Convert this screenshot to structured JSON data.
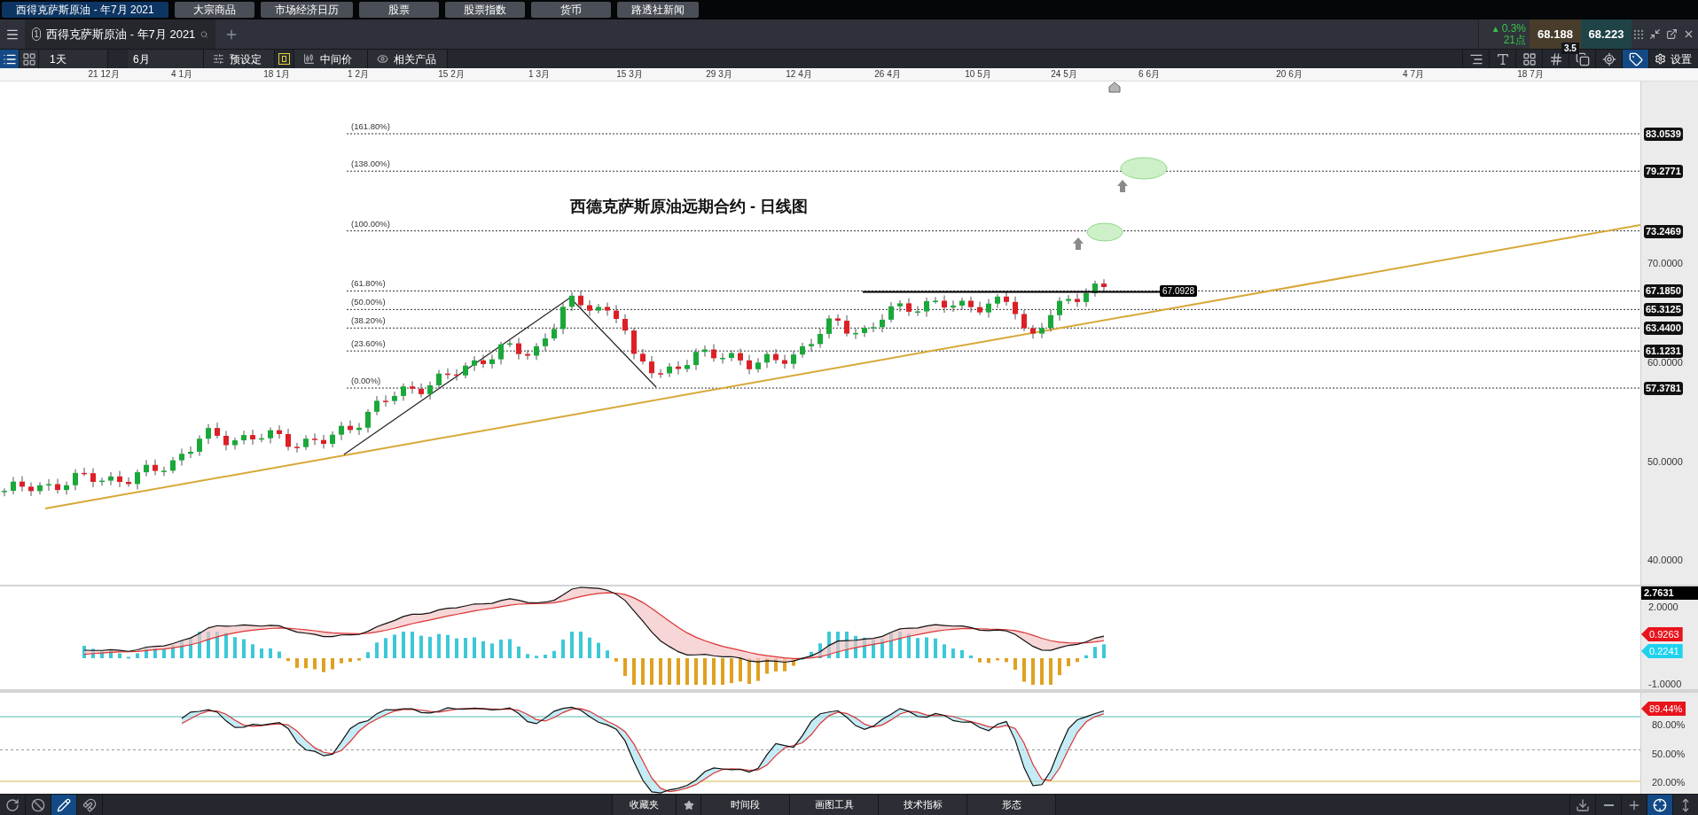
{
  "top_tabs": [
    {
      "label": "西得克萨斯原油 - 年7月 2021",
      "selected": true
    },
    {
      "label": "大宗商品",
      "selected": false
    },
    {
      "label": "市场经济日历",
      "selected": false
    },
    {
      "label": "股票",
      "selected": false
    },
    {
      "label": "股票指数",
      "selected": false
    },
    {
      "label": "货币",
      "selected": false
    },
    {
      "label": "路透社新闻",
      "selected": false
    }
  ],
  "instrument": {
    "index": "1",
    "title": "西得克萨斯原油 - 年7月 2021"
  },
  "quote": {
    "arrow": "▲",
    "change": "0.3%",
    "points": "21点",
    "sell": "68.188",
    "buy": "68.223",
    "spread": "3.5"
  },
  "view_modes": [
    {
      "kind": "list",
      "selected": true
    },
    {
      "kind": "grid",
      "selected": false
    }
  ],
  "toolbar": {
    "interval": "1天",
    "range": "6月",
    "preset": "预设定",
    "price_type": "中间价",
    "related": "相关产品",
    "settings": "设置"
  },
  "chart_tools": [
    {
      "kind": "lines",
      "selected": false
    },
    {
      "kind": "text",
      "selected": false
    },
    {
      "kind": "grid",
      "selected": false
    },
    {
      "kind": "draw",
      "selected": false
    },
    {
      "kind": "copy",
      "selected": false
    },
    {
      "kind": "marker",
      "selected": false
    },
    {
      "kind": "tag",
      "selected": true
    }
  ],
  "date_axis": [
    "21 12月",
    "4 1月",
    "18 1月",
    "1 2月",
    "15 2月",
    "1 3月",
    "15 3月",
    "29 3月",
    "12 4月",
    "26 4月",
    "10 5月",
    "24 5月",
    "6 6月",
    "20 6月",
    "4 7月",
    "18 7月"
  ],
  "main_chart": {
    "title": "西德克萨斯原油远期合约 - 日线图",
    "line_value": "67.0928",
    "price_ticks": [
      "70.0000",
      "60.0000",
      "50.0000",
      "40.0000"
    ],
    "fib_levels": [
      {
        "label": "(161.80%)",
        "value": "83.0539"
      },
      {
        "label": "(138.00%)",
        "value": "79.2771"
      },
      {
        "label": "(100.00%)",
        "value": "73.2469"
      },
      {
        "label": "(61.80%)",
        "value": "67.1850"
      },
      {
        "label": "(50.00%)",
        "value": "65.3125"
      },
      {
        "label": "(38.20%)",
        "value": "63.4400"
      },
      {
        "label": "(23.60%)",
        "value": "61.1231"
      },
      {
        "label": "(0.00%)",
        "value": "57.3781"
      }
    ]
  },
  "macd": {
    "current": "2.7631",
    "ticks": [
      "2.0000",
      "-1.0000"
    ],
    "tags": [
      {
        "value": "0.9263",
        "color": "#e8141c"
      },
      {
        "value": "0.2241",
        "color": "#1ed2ee"
      }
    ]
  },
  "stochastic": {
    "ticks": [
      "80.00%",
      "50.00%",
      "20.00%"
    ],
    "tags": [
      {
        "value": "89.44%",
        "color": "#e8141c"
      }
    ]
  },
  "left_tools": [
    {
      "kind": "reset",
      "selected": false
    },
    {
      "kind": "block",
      "selected": false
    },
    {
      "kind": "pencil",
      "selected": true
    },
    {
      "kind": "magnet",
      "selected": false
    }
  ],
  "bottom_tabs": [
    "收藏夹",
    "时间段",
    "画图工具",
    "技术指标",
    "形态"
  ],
  "right_tools": [
    {
      "kind": "download",
      "selected": false
    },
    {
      "kind": "zoom-out",
      "selected": false
    },
    {
      "kind": "zoom-in",
      "selected": false
    },
    {
      "kind": "crosshair",
      "selected": true
    },
    {
      "kind": "fit",
      "selected": false
    }
  ]
}
